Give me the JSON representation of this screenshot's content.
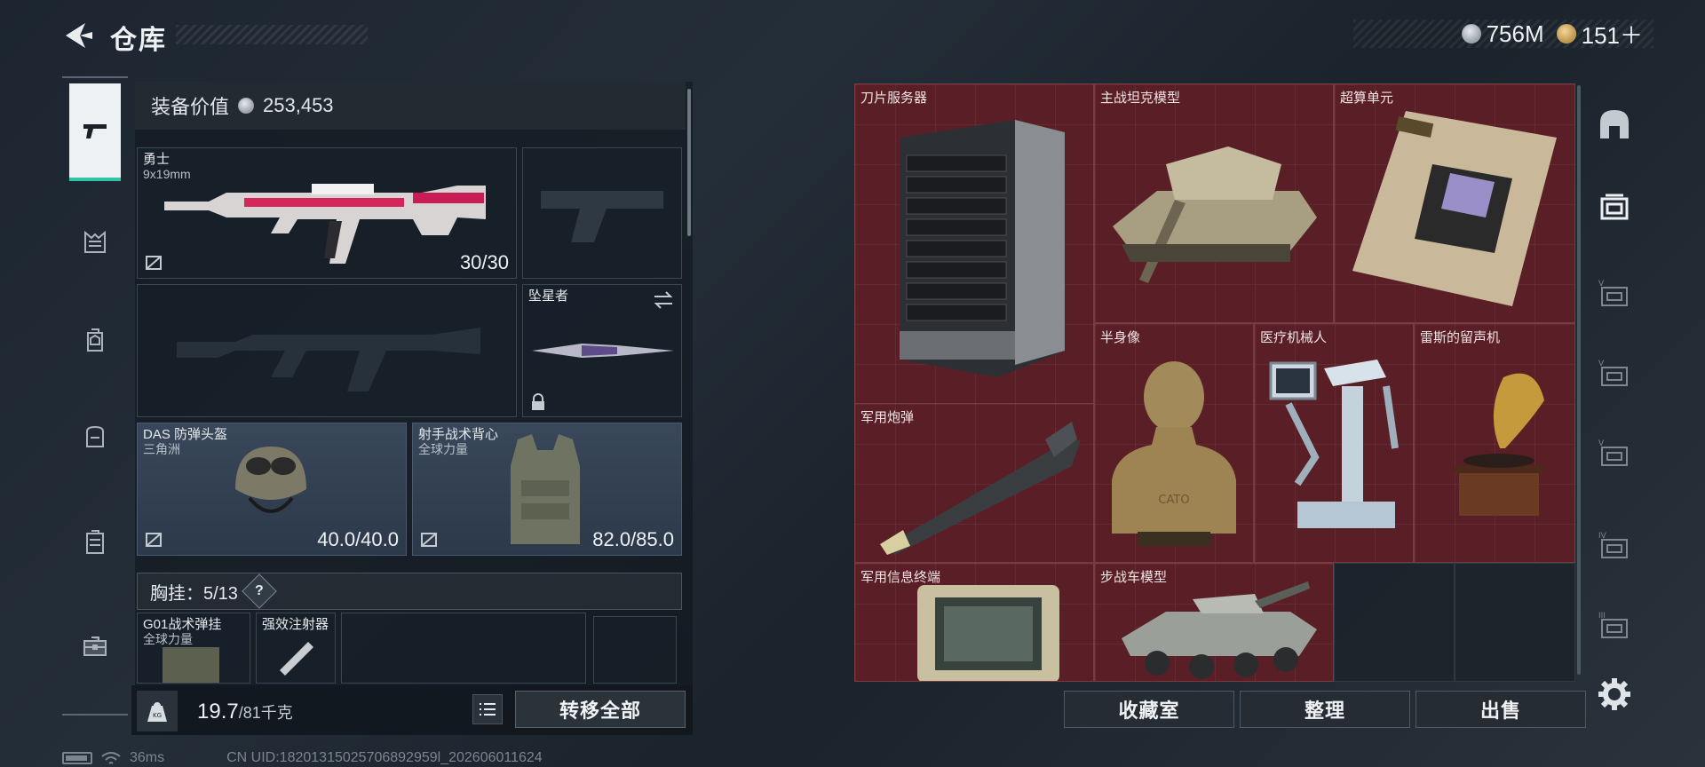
{
  "header": {
    "title": "仓库",
    "currency": [
      {
        "icon": "silver-coin-icon",
        "value": "756M"
      },
      {
        "icon": "gold-coin-icon",
        "value": "151＋"
      }
    ]
  },
  "left_nav": {
    "items": [
      {
        "icon": "pistol-icon",
        "active": true
      },
      {
        "icon": "rig-icon"
      },
      {
        "icon": "backpack-badge-icon"
      },
      {
        "icon": "backpack-icon"
      },
      {
        "icon": "case-icon"
      },
      {
        "icon": "toolbox-icon"
      }
    ]
  },
  "equipment": {
    "value_label": "装备价值",
    "value": "253,453",
    "primary_weapon": {
      "name": "勇士",
      "caliber": "9x19mm",
      "durability": "30/30"
    },
    "melee": {
      "name": "坠星者"
    },
    "helmet": {
      "name": "DAS 防弹头盔",
      "faction": "三角洲",
      "durability": "40.0/40.0"
    },
    "armor": {
      "name": "射手战术背心",
      "faction": "全球力量",
      "durability": "82.0/85.0"
    },
    "chest_rig": {
      "label": "胸挂：",
      "capacity": "5/13",
      "help": "?"
    },
    "rig_items": [
      {
        "name": "G01战术弹挂",
        "faction": "全球力量"
      },
      {
        "name": "强效注射器"
      }
    ]
  },
  "weight": {
    "current": "19.7",
    "max": "/81千克"
  },
  "buttons": {
    "transfer_all": "转移全部",
    "collection": "收藏室",
    "organize": "整理",
    "sell": "出售"
  },
  "storage_items": [
    {
      "name": "刀片服务器"
    },
    {
      "name": "主战坦克模型"
    },
    {
      "name": "超算单元"
    },
    {
      "name": "半身像"
    },
    {
      "name": "医疗机械人"
    },
    {
      "name": "雷斯的留声机"
    },
    {
      "name": "军用炮弹"
    },
    {
      "name": "军用信息终端"
    },
    {
      "name": "步战车模型"
    }
  ],
  "bust_inscription": "CATO",
  "status": {
    "ping": "36ms",
    "uid": "CN UID:18201315025706892959l_202606011624"
  },
  "colors": {
    "accent": "#2ec5a6",
    "storage_cell": "#5a1f26",
    "panel_bg": "#18212a"
  }
}
